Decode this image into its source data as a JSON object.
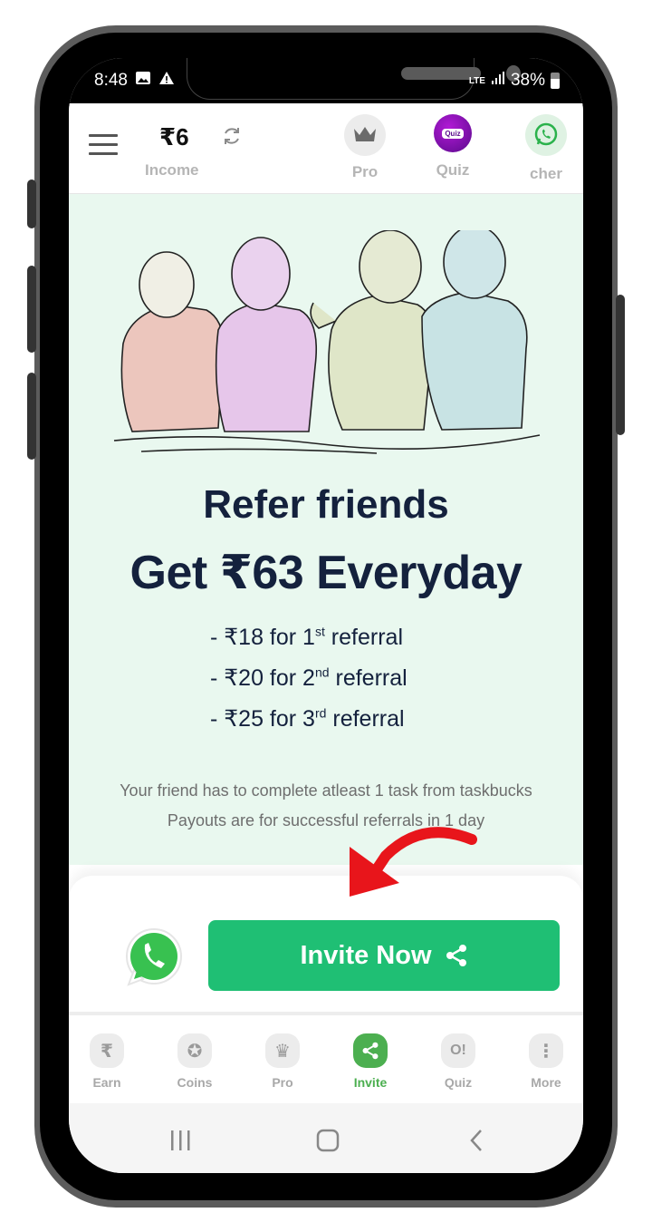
{
  "status_bar": {
    "time": "8:48",
    "network": "LTE",
    "battery": "38%"
  },
  "header": {
    "income_value": "₹6",
    "income_label": "Income",
    "items": [
      {
        "label": "Pro",
        "icon": "crown-icon"
      },
      {
        "label": "Quiz",
        "icon": "quiz-badge-icon",
        "badge_text": "Quiz"
      },
      {
        "label": "cher",
        "icon": "whatsapp-icon"
      }
    ]
  },
  "promo": {
    "title_line1": "Refer friends",
    "title_line2": "Get ₹63 Everyday",
    "rewards": [
      {
        "prefix": "- ₹18 for 1",
        "sup": "st",
        "suffix": " referral"
      },
      {
        "prefix": "- ₹20 for 2",
        "sup": "nd",
        "suffix": " referral"
      },
      {
        "prefix": "- ₹25 for 3",
        "sup": "rd",
        "suffix": " referral"
      }
    ],
    "note_1": "Your friend has to complete atleast 1 task from taskbucks",
    "note_2": "Payouts are for successful referrals in 1 day"
  },
  "invite": {
    "button_label": "Invite Now"
  },
  "bottom_nav": {
    "items": [
      {
        "label": "Earn",
        "glyph": "₹",
        "active": false
      },
      {
        "label": "Coins",
        "glyph": "✪",
        "active": false
      },
      {
        "label": "Pro",
        "glyph": "♛",
        "active": false
      },
      {
        "label": "Invite",
        "glyph": "",
        "active": true
      },
      {
        "label": "Quiz",
        "glyph": "O!",
        "active": false
      },
      {
        "label": "More",
        "glyph": "⋮",
        "active": false
      }
    ]
  },
  "colors": {
    "accent_green": "#1fbf74",
    "nav_active": "#4caf50",
    "promo_bg": "#e9f8ef",
    "title_navy": "#14213d",
    "arrow_red": "#e8151b"
  }
}
